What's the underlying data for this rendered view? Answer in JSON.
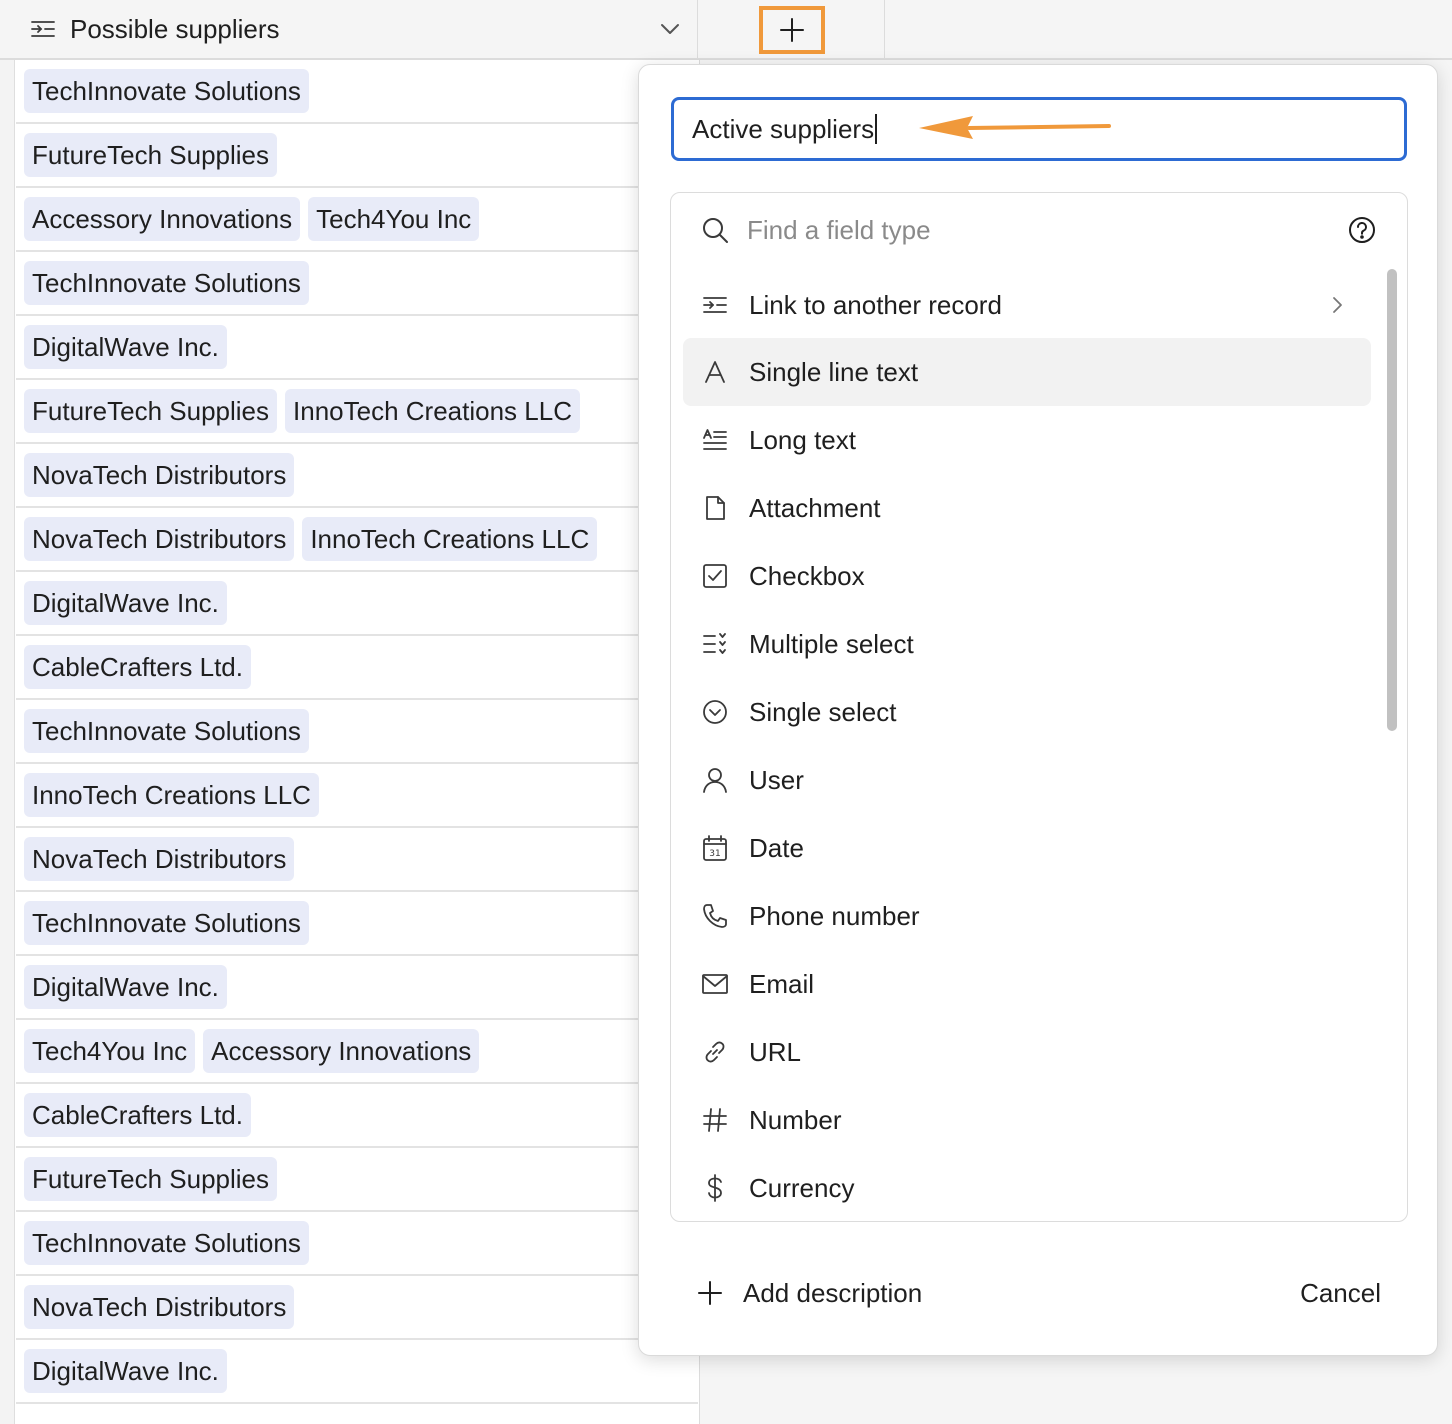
{
  "column": {
    "title": "Possible suppliers",
    "icon": "link-record-icon"
  },
  "add_column": {
    "icon": "plus-icon"
  },
  "rows": [
    [
      "TechInnovate Solutions"
    ],
    [
      "FutureTech Supplies"
    ],
    [
      "Accessory Innovations",
      "Tech4You Inc"
    ],
    [
      "TechInnovate Solutions"
    ],
    [
      "DigitalWave Inc."
    ],
    [
      "FutureTech Supplies",
      "InnoTech Creations LLC"
    ],
    [
      "NovaTech Distributors"
    ],
    [
      "NovaTech Distributors",
      "InnoTech Creations LLC"
    ],
    [
      "DigitalWave Inc."
    ],
    [
      "CableCrafters Ltd."
    ],
    [
      "TechInnovate Solutions"
    ],
    [
      "InnoTech Creations LLC"
    ],
    [
      "NovaTech Distributors"
    ],
    [
      "TechInnovate Solutions"
    ],
    [
      "DigitalWave Inc."
    ],
    [
      "Tech4You Inc",
      "Accessory Innovations"
    ],
    [
      "CableCrafters Ltd."
    ],
    [
      "FutureTech Supplies"
    ],
    [
      "TechInnovate Solutions"
    ],
    [
      "NovaTech Distributors"
    ],
    [
      "DigitalWave Inc."
    ]
  ],
  "popover": {
    "field_name_value": "Active suppliers",
    "search_placeholder": "Find a field type",
    "field_types": [
      {
        "label": "Link to another record",
        "icon": "link-record-icon",
        "has_submenu": true
      },
      {
        "label": "Single line text",
        "icon": "text-a-icon",
        "highlighted": true
      },
      {
        "label": "Long text",
        "icon": "long-text-icon"
      },
      {
        "label": "Attachment",
        "icon": "file-icon"
      },
      {
        "label": "Checkbox",
        "icon": "checkbox-icon"
      },
      {
        "label": "Multiple select",
        "icon": "multi-select-icon"
      },
      {
        "label": "Single select",
        "icon": "single-select-icon"
      },
      {
        "label": "User",
        "icon": "user-icon"
      },
      {
        "label": "Date",
        "icon": "calendar-icon"
      },
      {
        "label": "Phone number",
        "icon": "phone-icon"
      },
      {
        "label": "Email",
        "icon": "envelope-icon"
      },
      {
        "label": "URL",
        "icon": "link-chain-icon"
      },
      {
        "label": "Number",
        "icon": "hash-icon"
      },
      {
        "label": "Currency",
        "icon": "dollar-icon"
      }
    ],
    "add_description_label": "Add description",
    "cancel_label": "Cancel"
  },
  "colors": {
    "chip_bg": "#e8ebf8",
    "focus_border": "#2d6bd3",
    "annotation": "#f0993b",
    "highlight_bg": "#f2f2f2"
  }
}
